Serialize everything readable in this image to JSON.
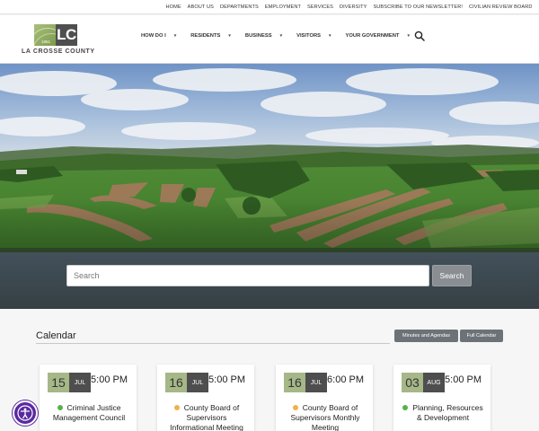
{
  "utility_nav": [
    {
      "label": "Home"
    },
    {
      "label": "About Us"
    },
    {
      "label": "Departments"
    },
    {
      "label": "Employment"
    },
    {
      "label": "Services"
    },
    {
      "label": "Diversity"
    },
    {
      "label": "Subscribe to our Newsletter!"
    },
    {
      "label": "Civilian Review Board"
    }
  ],
  "logo": {
    "mark": "LC",
    "year": "1851",
    "name": "LA CROSSE COUNTY"
  },
  "main_nav": [
    {
      "label": "How Do I"
    },
    {
      "label": "Residents"
    },
    {
      "label": "Business"
    },
    {
      "label": "Visitors"
    },
    {
      "label": "Your Government"
    }
  ],
  "hero_search": {
    "placeholder": "Search",
    "button": "Search"
  },
  "calendar": {
    "title": "Calendar",
    "minutes_button": "Minutes and Agendas",
    "full_button": "Full Calendar",
    "events": [
      {
        "day": "15",
        "month": "JUL",
        "time": "5:00 PM",
        "title": "Criminal Justice Management Council",
        "dot_color": "#5bb04a"
      },
      {
        "day": "16",
        "month": "JUL",
        "time": "5:00 PM",
        "title": "County Board of Supervisors Informational Meeting",
        "dot_color": "#f0b14a"
      },
      {
        "day": "16",
        "month": "JUL",
        "time": "6:00 PM",
        "title": "County Board of Supervisors Monthly Meeting",
        "dot_color": "#f0b14a"
      },
      {
        "day": "03",
        "month": "AUG",
        "time": "5:00 PM",
        "title": "Planning, Resources & Development",
        "dot_color": "#5bb04a"
      }
    ]
  },
  "colors": {
    "accent_green": "#a6b788",
    "dark": "#4e4e4e",
    "button_gray": "#6d7278",
    "a11y_purple": "#5a2aa0"
  }
}
